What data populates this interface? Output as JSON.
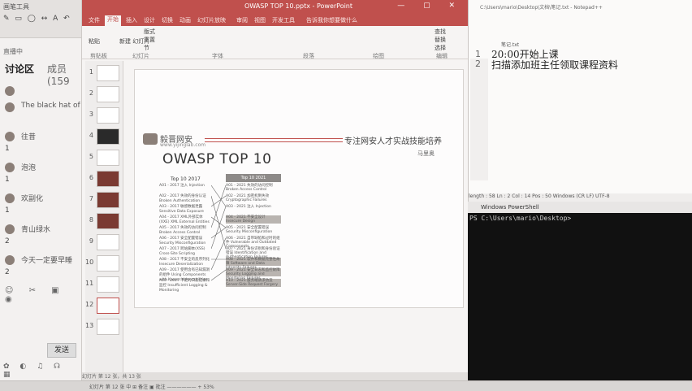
{
  "chat": {
    "toolbar_title": "画笔工具",
    "toolbar_icons": "✎ ▭ ◯ ↔ A ↶",
    "live_status": "直播中",
    "tab_discussion": "讨论区",
    "tab_members": "成员(159",
    "messages": [
      {
        "nick": "",
        "msg": ""
      },
      {
        "nick": "The black hat of",
        "msg": ""
      },
      {
        "nick": "往昔",
        "msg": "1"
      },
      {
        "nick": "泡泡",
        "msg": "1"
      },
      {
        "nick": "欢副化",
        "msg": "1"
      },
      {
        "nick": "青山绿水",
        "msg": "2"
      },
      {
        "nick": "今天一定要早睡",
        "msg": "2"
      }
    ],
    "footer_icons": "☺ ✂ ▣ ◉",
    "send_label": "发送",
    "bottom_icons": "✿ ◐ ♫ ☊ ▦"
  },
  "ppt": {
    "window_title": "OWASP TOP 10.pptx - PowerPoint",
    "menu": [
      "文件",
      "开始",
      "插入",
      "设计",
      "切换",
      "动画",
      "幻灯片放映",
      "审阅",
      "视图",
      "开发工具",
      "告诉我你想要做什么"
    ],
    "active_menu": "开始",
    "ribbon_groups": [
      "剪贴板",
      "幻灯片",
      "字体",
      "段落",
      "绘图",
      "编辑"
    ],
    "ribbon_buttons": {
      "paste": "粘贴",
      "new_slide": "新建\n幻灯片",
      "layout": "版式",
      "reset": "重置",
      "section": "节",
      "find": "查找",
      "replace": "替换",
      "select": "选择"
    },
    "thumbs": [
      "1",
      "2",
      "3",
      "4",
      "5",
      "6",
      "7",
      "8",
      "9",
      "10",
      "11",
      "12",
      "13"
    ],
    "slide": {
      "logo_text": "毅晋网安",
      "logo_sub": "www.yijinglab.com",
      "slogan": "专注网安人才实战技能培养",
      "author": "马里奥",
      "heading": "OWASP TOP 10",
      "left_header": "Top 10 2017",
      "right_header": "Top 10 2021",
      "left_items": [
        "A01 - 2017 注入 Injection",
        "A02 - 2017 失效的身份认证 Broken Authentication",
        "A03 - 2017 敏感数据泄露 Sensitive Data Exposure",
        "A04 - 2017 XML外部实体(XXE) XML External Entities",
        "A05 - 2017 失效的访问控制 Broken Access Control",
        "A06 - 2017 安全配置错误 Security Misconfiguration",
        "A07 - 2017 跨站脚本(XSS) Cross-Site Scripting",
        "A08 - 2017 不安全的反序列化 Insecure Deserialization",
        "A09 - 2017 使用含有已知漏洞的组件 Using Components with Known Vulnerabilities",
        "A10 - 2017 不足的日志记录和监控 Insufficient Logging & Monitoring"
      ],
      "right_items": [
        "A01 - 2021 失效的访问控制 Broken Access Control",
        "A02 - 2021 加密机制失效 Cryptographic Failures",
        "A03 - 2021 注入 Injection",
        "A04 - 2021 不安全设计 Insecure Design",
        "A05 - 2021 安全配置错误 Security Misconfiguration",
        "A06 - 2021 自带缺陷和过时的组件 Vulnerable and Outdated Components",
        "A07 - 2021 身份识别和身份验证错误 Identification and Authentication Failures",
        "A08 - 2021 软件和数据完整性故障 Software and Data Integrity Failures",
        "A09 - 2021 安全日志和监控故障 Security Logging and Monitoring Failures",
        "A10 - 2021 服务端请求伪造 Server-Side Request Forgery"
      ]
    },
    "statusbar": "幻灯片 第 12 张，共 13 张"
  },
  "notepad": {
    "title": "C:\\Users\\mario\\Desktop\\文档\\笔记.txt - Notepad++",
    "tab_label": "笔记.txt",
    "lines": [
      "20:00开始上课",
      "扫描添加班主任领取课程资料"
    ],
    "line_numbers": [
      "1",
      "2"
    ],
    "status": "length : 58    Ln : 2    Col : 14    Pos : 50        Windows (CR LF)    UTF-8"
  },
  "powershell": {
    "title": "Windows PowerShell",
    "prompt": "PS C:\\Users\\mario\\Desktop>"
  },
  "taskbar": {
    "text": "幻灯片 第 12 张    中    ⊞ 备注    ▣ 批注    —————— + 53%"
  }
}
